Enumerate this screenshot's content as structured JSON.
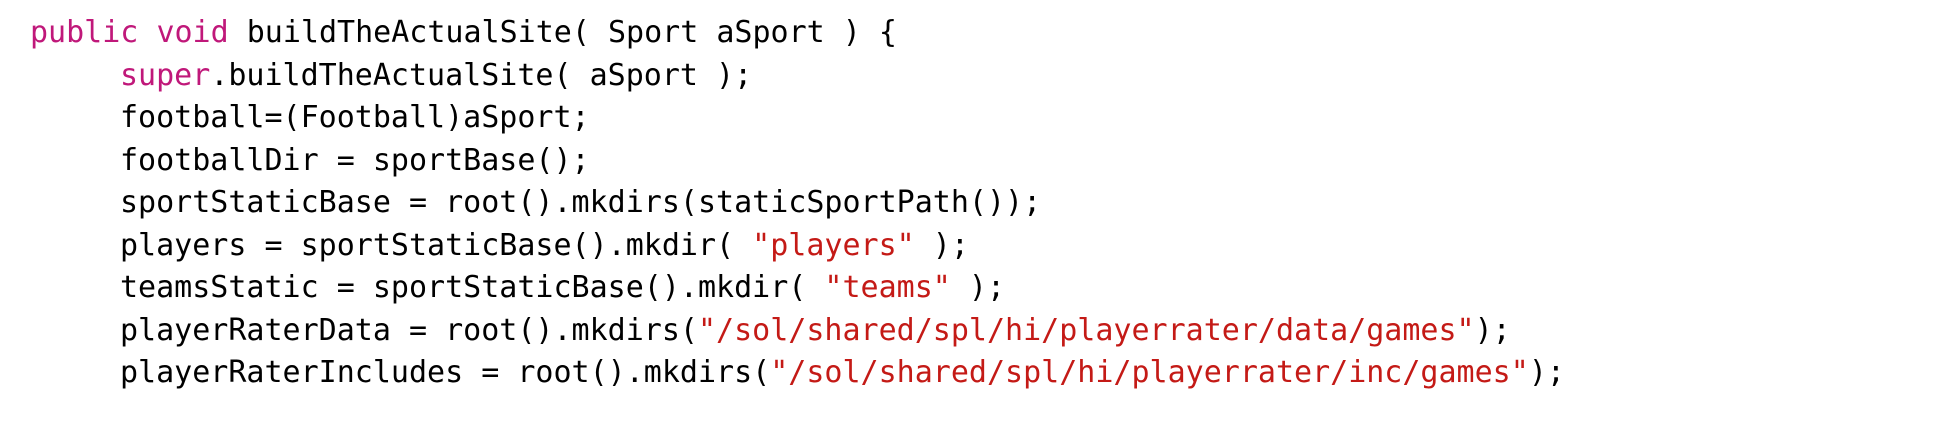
{
  "colors": {
    "background": "#ffffff",
    "plain": "#000000",
    "keyword": "#c0187a",
    "string": "#c41a16"
  },
  "lines": [
    {
      "indent": 0,
      "tokens": [
        {
          "type": "keyword",
          "text": "public"
        },
        {
          "type": "plain",
          "text": " "
        },
        {
          "type": "keyword",
          "text": "void"
        },
        {
          "type": "plain",
          "text": " buildTheActualSite( Sport aSport ) {"
        }
      ]
    },
    {
      "indent": 1,
      "tokens": [
        {
          "type": "keyword",
          "text": "super"
        },
        {
          "type": "plain",
          "text": ".buildTheActualSite( aSport );"
        }
      ]
    },
    {
      "indent": 1,
      "tokens": [
        {
          "type": "plain",
          "text": "football=(Football)aSport;"
        }
      ]
    },
    {
      "indent": 1,
      "tokens": [
        {
          "type": "plain",
          "text": "footballDir = sportBase();"
        }
      ]
    },
    {
      "indent": 1,
      "tokens": [
        {
          "type": "plain",
          "text": "sportStaticBase = root().mkdirs(staticSportPath());"
        }
      ]
    },
    {
      "indent": 1,
      "tokens": [
        {
          "type": "plain",
          "text": "players = sportStaticBase().mkdir( "
        },
        {
          "type": "string",
          "text": "\"players\""
        },
        {
          "type": "plain",
          "text": " );"
        }
      ]
    },
    {
      "indent": 1,
      "tokens": [
        {
          "type": "plain",
          "text": "teamsStatic = sportStaticBase().mkdir( "
        },
        {
          "type": "string",
          "text": "\"teams\""
        },
        {
          "type": "plain",
          "text": " );"
        }
      ]
    },
    {
      "indent": 1,
      "tokens": [
        {
          "type": "plain",
          "text": "playerRaterData = root().mkdirs("
        },
        {
          "type": "string",
          "text": "\"/sol/shared/spl/hi/playerrater/data/games\""
        },
        {
          "type": "plain",
          "text": ");"
        }
      ]
    },
    {
      "indent": 1,
      "tokens": [
        {
          "type": "plain",
          "text": "playerRaterIncludes = root().mkdirs("
        },
        {
          "type": "string",
          "text": "\"/sol/shared/spl/hi/playerrater/inc/games\""
        },
        {
          "type": "plain",
          "text": ");"
        }
      ]
    }
  ]
}
